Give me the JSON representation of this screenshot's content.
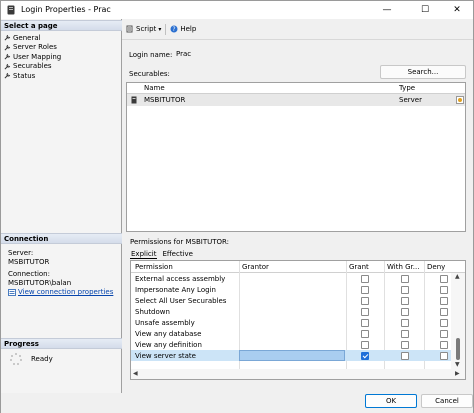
{
  "window": {
    "title": "Login Properties - Prac",
    "controls": {
      "minimize": "—",
      "maximize": "☐",
      "close": "✕"
    }
  },
  "left": {
    "select_page_header": "Select a page",
    "pages": [
      "General",
      "Server Roles",
      "User Mapping",
      "Securables",
      "Status"
    ],
    "connection_header": "Connection",
    "server_label": "Server:",
    "server_value": "MSBITUTOR",
    "connection_label": "Connection:",
    "connection_value": "MSBITUTOR\\balan",
    "view_connection_link": "View connection properties",
    "progress_header": "Progress",
    "progress_status": "Ready"
  },
  "toolbar": {
    "script_label": "Script",
    "help_label": "Help"
  },
  "form": {
    "login_name_label": "Login name:",
    "login_name_value": "Prac",
    "securables_label": "Securables:",
    "search_button": "Search..."
  },
  "securables_grid": {
    "columns": [
      "Name",
      "Type"
    ],
    "rows": [
      {
        "name": "MSBITUTOR",
        "type": "Server"
      }
    ]
  },
  "permissions": {
    "label": "Permissions for MSBITUTOR:",
    "tabs": [
      "Explicit",
      "Effective"
    ],
    "columns": [
      "Permission",
      "Grantor",
      "Grant",
      "With Gr...",
      "Deny"
    ],
    "rows": [
      {
        "permission": "External access assembly",
        "grant": false,
        "with_grant": false,
        "deny": false
      },
      {
        "permission": "Impersonate Any Login",
        "grant": false,
        "with_grant": false,
        "deny": false
      },
      {
        "permission": "Select All User Securables",
        "grant": false,
        "with_grant": false,
        "deny": false
      },
      {
        "permission": "Shutdown",
        "grant": false,
        "with_grant": false,
        "deny": false
      },
      {
        "permission": "Unsafe assembly",
        "grant": false,
        "with_grant": false,
        "deny": false
      },
      {
        "permission": "View any database",
        "grant": false,
        "with_grant": false,
        "deny": false
      },
      {
        "permission": "View any definition",
        "grant": false,
        "with_grant": false,
        "deny": false
      },
      {
        "permission": "View server state",
        "grant": true,
        "with_grant": false,
        "deny": false
      }
    ]
  },
  "footer": {
    "ok": "OK",
    "cancel": "Cancel"
  },
  "colors": {
    "accent": "#0078d4",
    "selection": "#cce4f7",
    "link": "#0645ad"
  }
}
